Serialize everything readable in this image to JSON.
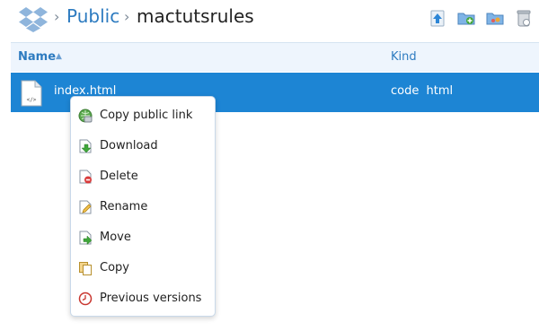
{
  "breadcrumb": {
    "separator": "›",
    "parent": "Public",
    "current": "mactutsrules"
  },
  "toolbar": {
    "buttons": [
      "upload-icon",
      "new-folder-icon",
      "share-folder-icon",
      "deleted-files-icon"
    ]
  },
  "table": {
    "columns": {
      "name": "Name",
      "sort_indicator": "▲",
      "kind": "Kind"
    },
    "rows": [
      {
        "name": "index.html",
        "kind": "code html",
        "selected": true
      }
    ]
  },
  "context_menu": {
    "items": [
      {
        "label": "Copy public link",
        "icon": "link-icon"
      },
      {
        "label": "Download",
        "icon": "download-icon"
      },
      {
        "label": "Delete",
        "icon": "delete-icon"
      },
      {
        "label": "Rename",
        "icon": "rename-icon"
      },
      {
        "label": "Move",
        "icon": "move-icon"
      },
      {
        "label": "Copy",
        "icon": "copy-icon"
      },
      {
        "label": "Previous versions",
        "icon": "history-icon"
      }
    ]
  },
  "colors": {
    "accent": "#2d7bc0",
    "selection": "#1d85d4",
    "header_bg": "#eef5fd"
  }
}
